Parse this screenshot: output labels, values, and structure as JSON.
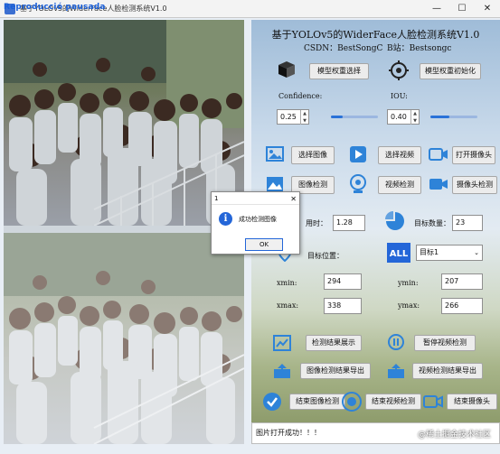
{
  "window": {
    "title": "基于YOLOv5的WiderFace人脸检测系统V1.0",
    "watermark_badge": "Reproducció pausada",
    "minimize": "—",
    "maximize": "☐",
    "close": "✕"
  },
  "header": {
    "title": "基于YOLOv5的WiderFace人脸检测系统V1.0",
    "csdn": "CSDN：BestSongC",
    "bili": "B站：Bestsongc"
  },
  "model": {
    "select_label": "模型权重选择",
    "init_label": "模型权重初始化"
  },
  "params": {
    "confidence_label": "Confidence:",
    "confidence_value": "0.25",
    "confidence_level": 0.25,
    "iou_label": "IOU:",
    "iou_value": "0.40",
    "iou_level": 0.4
  },
  "sources": {
    "select_image": "选择图像",
    "select_video": "选择视频",
    "open_camera": "打开摄像头",
    "image_detect": "图像检测",
    "video_detect": "视频检测",
    "camera_detect": "摄像头检测"
  },
  "results": {
    "time_label": "用时：",
    "time_value": "1.28",
    "count_label": "目标数量：",
    "count_value": "23",
    "position_label": "目标位置：",
    "target_select": "目标1",
    "xmin_label": "xmin:",
    "xmin_value": "294",
    "ymin_label": "ymin:",
    "ymin_value": "207",
    "xmax_label": "xmax:",
    "xmax_value": "338",
    "ymax_label": "ymax:",
    "ymax_value": "266"
  },
  "actions": {
    "show_results": "检测结果展示",
    "pause_video": "暂停视频检测",
    "export_image": "图像检测结果导出",
    "export_video": "视频检测结果导出",
    "end_image": "结束图像检测",
    "end_video": "结束视频检测",
    "end_camera": "结束摄像头"
  },
  "status": {
    "message": "图片打开成功！！！"
  },
  "watermark": "@稀土掘金技术社区",
  "dialog": {
    "title": "1",
    "message": "成功检测图像",
    "ok": "OK",
    "close": "✕",
    "icon_glyph": "i"
  },
  "colors": {
    "accent": "#2a72d8",
    "icon_blue": "#2e83d8"
  }
}
